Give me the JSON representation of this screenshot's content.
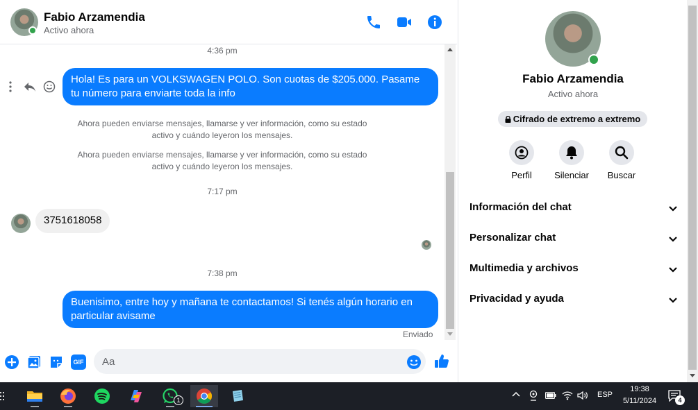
{
  "header": {
    "name": "Fabio Arzamendia",
    "status": "Activo ahora"
  },
  "messages": {
    "time1": "4:36 pm",
    "msg1": "Hola! Es para un VOLKSWAGEN POLO. Son cuotas de $205.000. Pasame tu número para enviarte toda la info",
    "sys1": "Ahora pueden enviarse mensajes, llamarse y ver información, como su estado activo y cuándo leyeron los mensajes.",
    "sys2": "Ahora pueden enviarse mensajes, llamarse y ver información, como su estado activo y cuándo leyeron los mensajes.",
    "time2": "7:17 pm",
    "msg2": "3751618058",
    "time3": "7:38 pm",
    "msg3": "Buenisimo, entre hoy y mañana te contactamos! Si tenés algún horario en particular avisame",
    "delivery_status": "Enviado"
  },
  "composer": {
    "placeholder": "Aa",
    "gif_label": "GIF"
  },
  "panel": {
    "name": "Fabio Arzamendia",
    "status": "Activo ahora",
    "e2e": "Cifrado de extremo a extremo",
    "actions": [
      {
        "label": "Perfil",
        "icon": "profile-icon"
      },
      {
        "label": "Silenciar",
        "icon": "bell-icon"
      },
      {
        "label": "Buscar",
        "icon": "search-icon"
      }
    ],
    "sections": [
      "Información del chat",
      "Personalizar chat",
      "Multimedia y archivos",
      "Privacidad y ayuda"
    ]
  },
  "taskbar": {
    "whatsapp_badge": "1",
    "language": "ESP",
    "time": "19:38",
    "date": "5/11/2024",
    "notifications": "4"
  },
  "colors": {
    "accent": "#0a7cff",
    "online": "#31a24c",
    "icon_blue": "#0a7cff"
  }
}
